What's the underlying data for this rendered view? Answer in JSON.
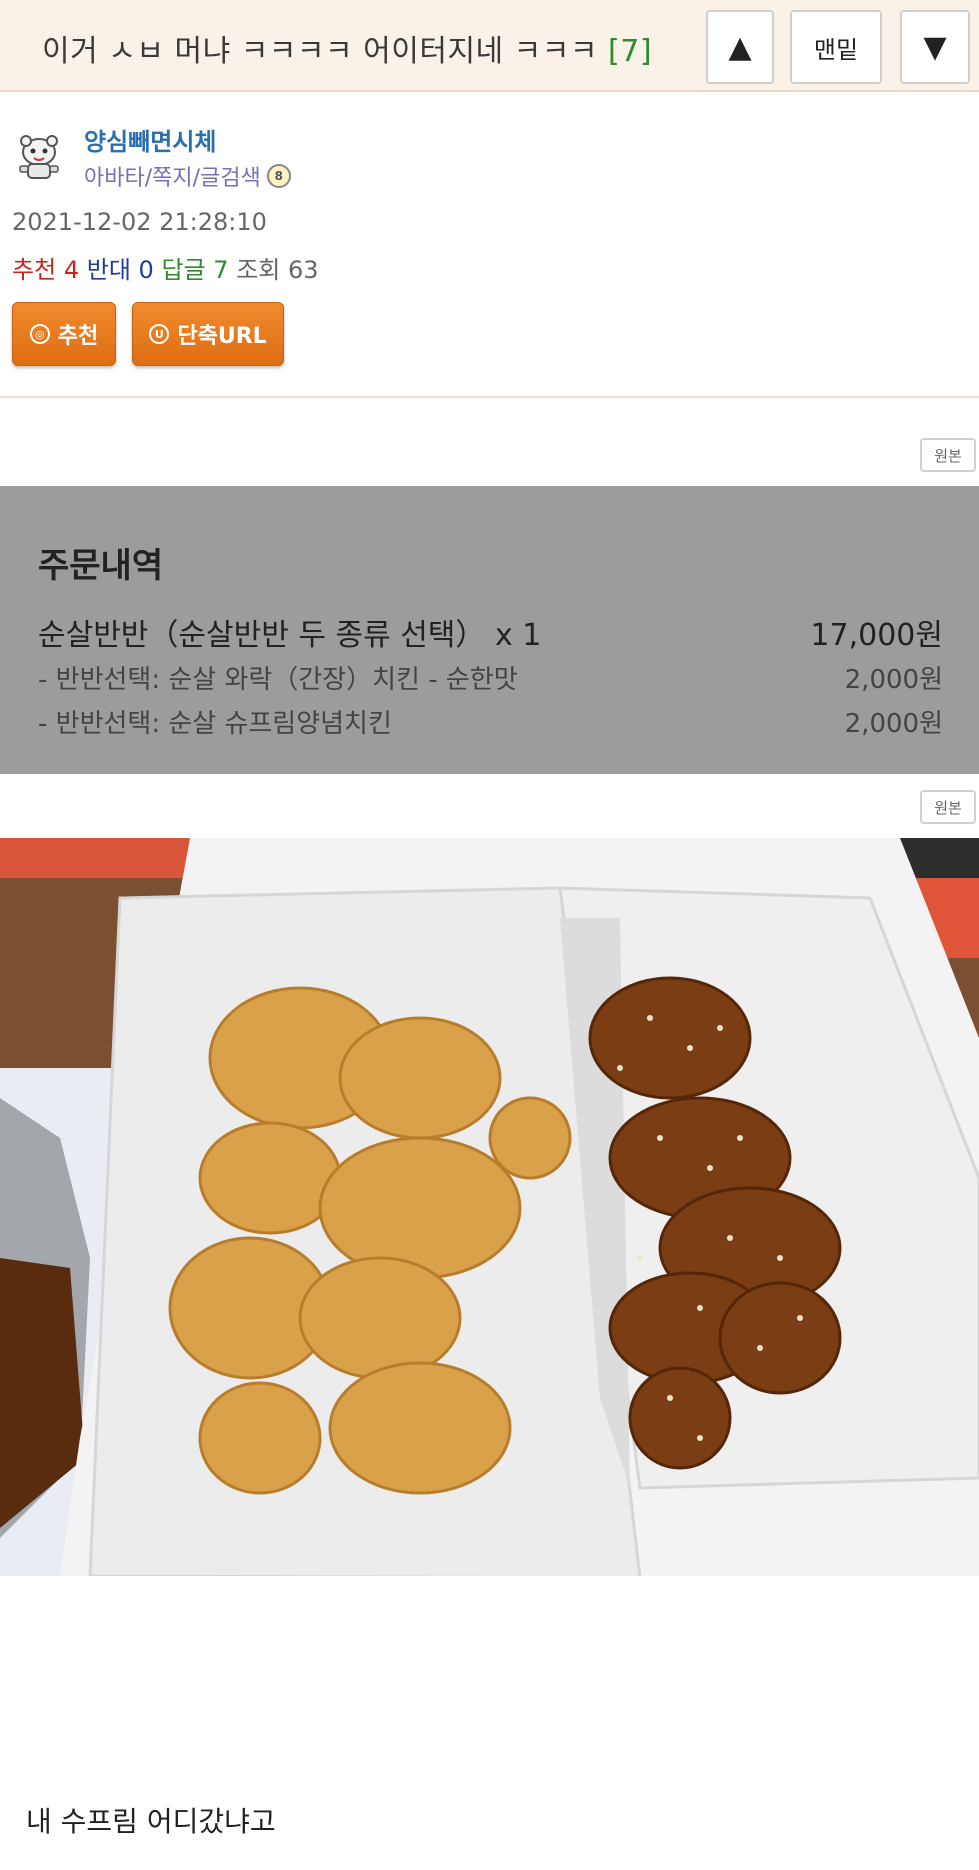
{
  "header": {
    "title": "이거 ㅅㅂ 머냐 ㅋㅋㅋㅋ 어이터지네 ㅋㅋㅋ",
    "comment_count": "[7]",
    "up_icon": "▲",
    "bottom_label": "맨밑",
    "down_icon": "▼"
  },
  "author": {
    "nickname": "양심빼면시체",
    "links": "아바타/쪽지/글검색",
    "level": "8"
  },
  "post": {
    "datetime": "2021-12-02 21:28:10",
    "recommend_label": "추천",
    "recommend_count": "4",
    "oppose_label": "반대",
    "oppose_count": "0",
    "reply_label": "답글",
    "reply_count": "7",
    "view_label": "조회",
    "view_count": "63",
    "body": "내 수프림 어디갔냐고"
  },
  "actions": {
    "recommend_label": "추천",
    "shorturl_label": "단축URL"
  },
  "original_label": "원본",
  "order": {
    "title": "주문내역",
    "item": "순살반반（순살반반 두 종류 선택） x 1",
    "item_price": "17,000원",
    "options": [
      {
        "label": "- 반반선택: 순살 와락（간장）치킨 - 순한맛",
        "price": "2,000원"
      },
      {
        "label": "- 반반선택: 순살 슈프림양념치킨",
        "price": "2,000원"
      }
    ]
  },
  "colors": {
    "header_bg": "#faf1e8",
    "button_orange": "#e8791e",
    "order_panel_bg": "#9c9c9c"
  }
}
